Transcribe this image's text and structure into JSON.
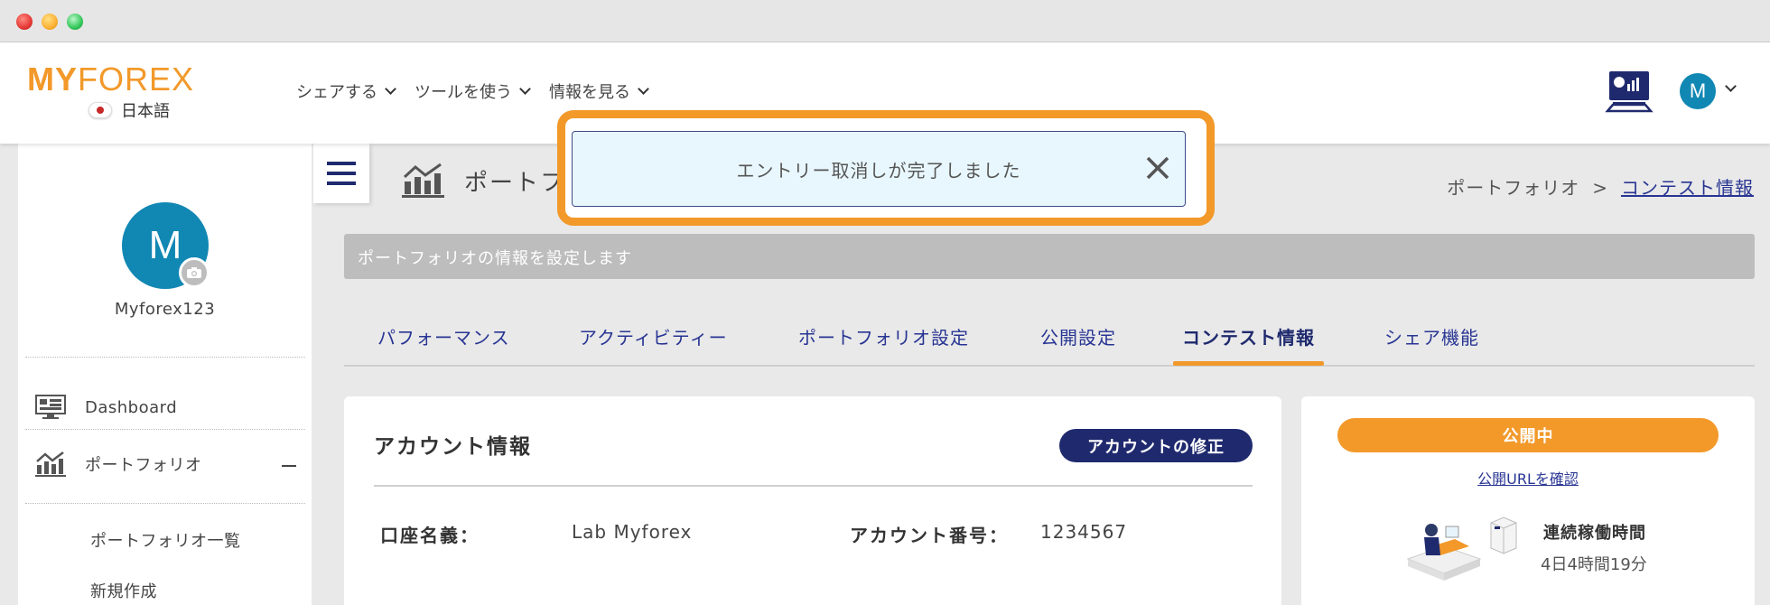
{
  "header": {
    "logo_my": "MY",
    "logo_forex": "FOREX",
    "language": "日本語",
    "nav": [
      {
        "label": "シェアする"
      },
      {
        "label": "ツールを使う"
      },
      {
        "label": "情報を見る"
      }
    ],
    "avatar_initial": "M"
  },
  "sidebar": {
    "avatar_initial": "M",
    "username": "Myforex123",
    "items": [
      {
        "label": "Dashboard",
        "icon": "monitor-icon"
      },
      {
        "label": "ポートフォリオ",
        "icon": "chart-icon"
      }
    ],
    "subitems": [
      {
        "label": "ポートフォリオ一覧"
      },
      {
        "label": "新規作成"
      }
    ]
  },
  "page": {
    "title": "ポートフォ",
    "breadcrumb": {
      "parent": "ポートフォリオ",
      "separator": ">",
      "current": "コンテスト情報"
    },
    "notice": "ポートフォリオの情報を設定します"
  },
  "tabs": [
    {
      "label": "パフォーマンス"
    },
    {
      "label": "アクティビティー"
    },
    {
      "label": "ポートフォリオ設定"
    },
    {
      "label": "公開設定"
    },
    {
      "label": "コンテスト情報"
    },
    {
      "label": "シェア機能"
    }
  ],
  "account_card": {
    "title": "アカウント情報",
    "edit_button": "アカウントの修正",
    "name_label": "口座名義：",
    "name_value": "Lab Myforex",
    "number_label": "アカウント番号：",
    "number_value": "1234567"
  },
  "status_card": {
    "public_button": "公開中",
    "public_link": "公開URLを確認",
    "uptime_label": "連続稼働時間",
    "uptime_value": "4日4時間19分"
  },
  "toast": {
    "message": "エントリー取消しが完了しました"
  },
  "colors": {
    "brand_orange": "#f2992a",
    "navy": "#1f2a6e",
    "avatar_blue": "#1187b3"
  }
}
